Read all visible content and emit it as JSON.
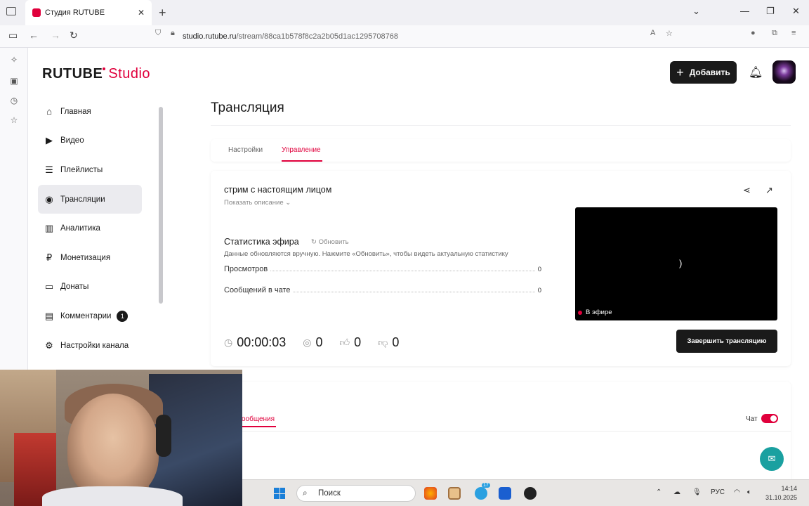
{
  "browser": {
    "tab_title": "Студия RUTUBE",
    "new_tab": "+",
    "close_tab": "✕",
    "url_domain": "studio.rutube.ru",
    "url_path": "/stream/88ca1b578f8c2a2b05d1ac1295708768"
  },
  "studio": {
    "logo_main": "RUTUBE",
    "logo_sub": "Studio",
    "add_label": "Добавить",
    "menu": [
      {
        "label": "Главная",
        "icon": "home-icon"
      },
      {
        "label": "Видео",
        "icon": "video-icon"
      },
      {
        "label": "Плейлисты",
        "icon": "playlist-icon"
      },
      {
        "label": "Трансляции",
        "icon": "broadcast-icon"
      },
      {
        "label": "Аналитика",
        "icon": "analytics-icon"
      },
      {
        "label": "Монетизация",
        "icon": "ruble-icon"
      },
      {
        "label": "Донаты",
        "icon": "wallet-icon"
      },
      {
        "label": "Комментарии",
        "icon": "comment-icon",
        "badge": "1"
      },
      {
        "label": "Настройки канала",
        "icon": "gear-icon"
      }
    ],
    "active_menu": "Трансляции",
    "page_title": "Трансляция",
    "tabs": {
      "settings": "Настройки",
      "control": "Управление"
    },
    "stream": {
      "name": "стрим с настоящим лицом",
      "show_description": "Показать описание",
      "stats_title": "Статистика эфира",
      "refresh": "Обновить",
      "stats_note": "Данные обновляются вручную. Нажмите «Обновить», чтобы видеть актуальную статистику",
      "views_label": "Просмотров",
      "views_value": "0",
      "messages_label": "Сообщений в чате",
      "messages_value": "0",
      "timer": "00:00:03",
      "viewers": "0",
      "likes": "0",
      "dislikes": "0",
      "live_label": "В эфире",
      "video_glyph": ")",
      "end_button": "Завершить трансляцию"
    },
    "chat": {
      "tab_label": "ообщения",
      "chat_label": "Чат",
      "chat_enabled": true
    }
  },
  "taskbar": {
    "search_placeholder": "Поиск",
    "lang": "РУС",
    "time": "14:14",
    "date": "31.10.2025",
    "telegram_badge": "17"
  },
  "colors": {
    "accent": "#e0003c",
    "dark": "#1a1a1a"
  }
}
